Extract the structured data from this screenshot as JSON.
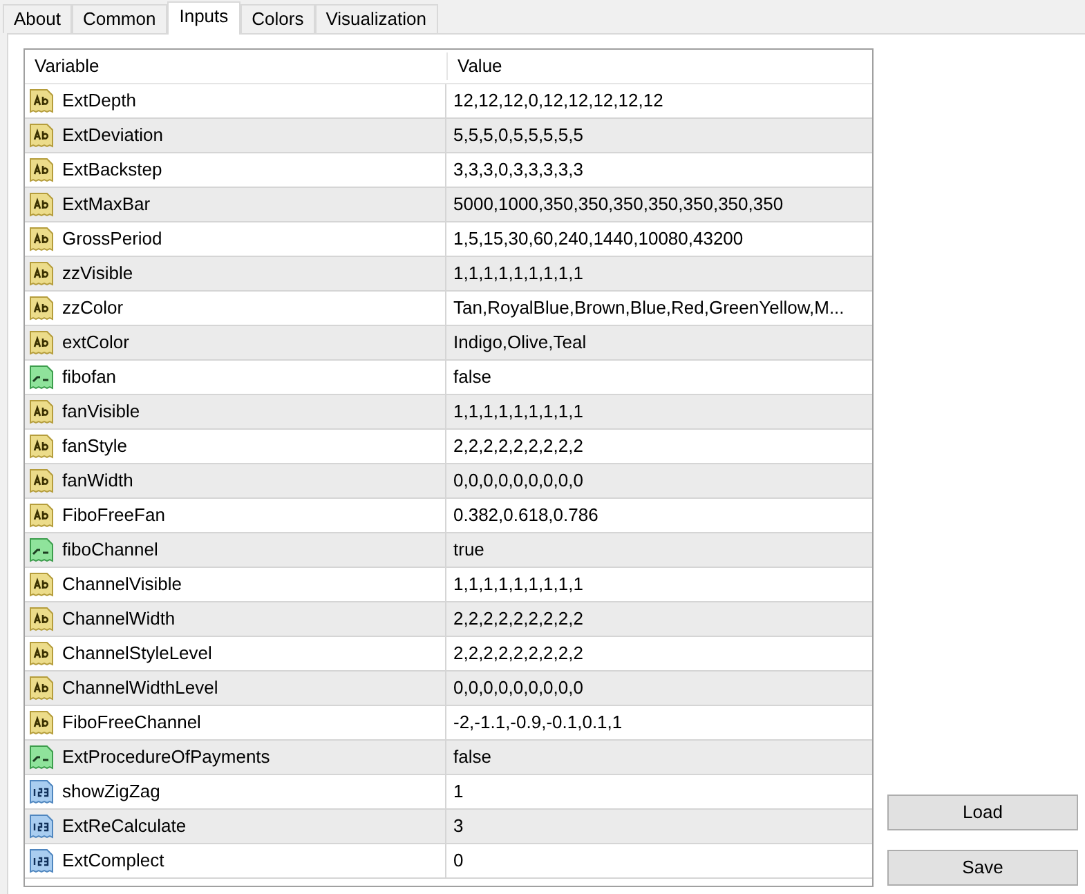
{
  "tabs": [
    {
      "label": "About",
      "selected": false
    },
    {
      "label": "Common",
      "selected": false
    },
    {
      "label": "Inputs",
      "selected": true
    },
    {
      "label": "Colors",
      "selected": false
    },
    {
      "label": "Visualization",
      "selected": false
    }
  ],
  "table": {
    "columns": [
      "Variable",
      "Value"
    ],
    "rows": [
      {
        "kind": "string",
        "variable": "ExtDepth",
        "value": "12,12,12,0,12,12,12,12,12"
      },
      {
        "kind": "string",
        "variable": "ExtDeviation",
        "value": "5,5,5,0,5,5,5,5,5"
      },
      {
        "kind": "string",
        "variable": "ExtBackstep",
        "value": "3,3,3,0,3,3,3,3,3"
      },
      {
        "kind": "string",
        "variable": "ExtMaxBar",
        "value": "5000,1000,350,350,350,350,350,350,350"
      },
      {
        "kind": "string",
        "variable": "GrossPeriod",
        "value": "1,5,15,30,60,240,1440,10080,43200"
      },
      {
        "kind": "string",
        "variable": "zzVisible",
        "value": "1,1,1,1,1,1,1,1,1"
      },
      {
        "kind": "string",
        "variable": "zzColor",
        "value": "Tan,RoyalBlue,Brown,Blue,Red,GreenYellow,M..."
      },
      {
        "kind": "string",
        "variable": "extColor",
        "value": "Indigo,Olive,Teal"
      },
      {
        "kind": "bool",
        "variable": "fibofan",
        "value": "false"
      },
      {
        "kind": "string",
        "variable": "fanVisible",
        "value": "1,1,1,1,1,1,1,1,1"
      },
      {
        "kind": "string",
        "variable": "fanStyle",
        "value": "2,2,2,2,2,2,2,2,2"
      },
      {
        "kind": "string",
        "variable": "fanWidth",
        "value": "0,0,0,0,0,0,0,0,0"
      },
      {
        "kind": "string",
        "variable": "FiboFreeFan",
        "value": "0.382,0.618,0.786"
      },
      {
        "kind": "bool",
        "variable": "fiboChannel",
        "value": "true"
      },
      {
        "kind": "string",
        "variable": "ChannelVisible",
        "value": "1,1,1,1,1,1,1,1,1"
      },
      {
        "kind": "string",
        "variable": "ChannelWidth",
        "value": "2,2,2,2,2,2,2,2,2"
      },
      {
        "kind": "string",
        "variable": "ChannelStyleLevel",
        "value": "2,2,2,2,2,2,2,2,2"
      },
      {
        "kind": "string",
        "variable": "ChannelWidthLevel",
        "value": "0,0,0,0,0,0,0,0,0"
      },
      {
        "kind": "string",
        "variable": "FiboFreeChannel",
        "value": "-2,-1.1,-0.9,-0.1,0.1,1"
      },
      {
        "kind": "bool",
        "variable": "ExtProcedureOfPayments",
        "value": "false"
      },
      {
        "kind": "int",
        "variable": "showZigZag",
        "value": "1"
      },
      {
        "kind": "int",
        "variable": "ExtReCalculate",
        "value": "3"
      },
      {
        "kind": "int",
        "variable": "ExtComplect",
        "value": "0"
      }
    ]
  },
  "buttons": [
    "Load",
    "Save"
  ]
}
